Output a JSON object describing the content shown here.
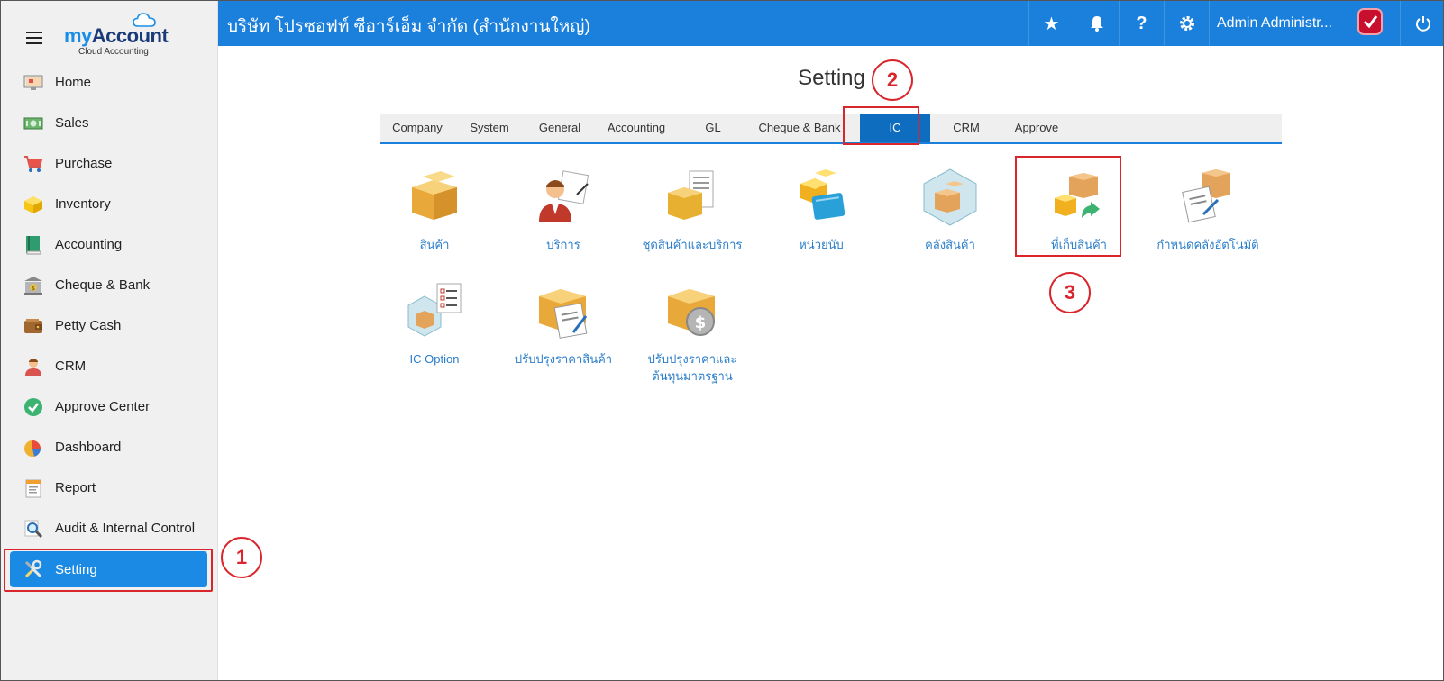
{
  "brand": {
    "logo_my": "my",
    "logo_account": "Account",
    "logo_sub": "Cloud Accounting"
  },
  "sidebar": {
    "items": [
      {
        "label": "Home",
        "icon": "home-monitor-icon"
      },
      {
        "label": "Sales",
        "icon": "cash-icon"
      },
      {
        "label": "Purchase",
        "icon": "cart-icon"
      },
      {
        "label": "Inventory",
        "icon": "box-icon"
      },
      {
        "label": "Accounting",
        "icon": "book-icon"
      },
      {
        "label": "Cheque & Bank",
        "icon": "bank-icon"
      },
      {
        "label": "Petty Cash",
        "icon": "wallet-icon"
      },
      {
        "label": "CRM",
        "icon": "person-icon"
      },
      {
        "label": "Approve Center",
        "icon": "check-circle-icon"
      },
      {
        "label": "Dashboard",
        "icon": "pie-chart-icon"
      },
      {
        "label": "Report",
        "icon": "report-icon"
      },
      {
        "label": "Audit & Internal Control",
        "icon": "magnifier-icon"
      },
      {
        "label": "Setting",
        "icon": "tools-icon",
        "active": true
      }
    ]
  },
  "topbar": {
    "company": "บริษัท โปรซอฟท์ ซีอาร์เอ็ม จำกัด (สำนักงานใหญ่)",
    "star": "★",
    "help": "?",
    "user": "Admin Administr..."
  },
  "main": {
    "title": "Setting",
    "tabs": [
      {
        "label": "Company"
      },
      {
        "label": "System"
      },
      {
        "label": "General"
      },
      {
        "label": "Accounting"
      },
      {
        "label": "GL"
      },
      {
        "label": "Cheque & Bank"
      },
      {
        "label": "IC",
        "active": true
      },
      {
        "label": "CRM"
      },
      {
        "label": "Approve"
      }
    ],
    "tiles": [
      {
        "label": "สินค้า",
        "icon": "product-boxes-icon"
      },
      {
        "label": "บริการ",
        "icon": "service-person-icon"
      },
      {
        "label": "ชุดสินค้าและบริการ",
        "icon": "product-set-icon"
      },
      {
        "label": "หน่วยนับ",
        "icon": "unit-icon"
      },
      {
        "label": "คลังสินค้า",
        "icon": "warehouse-icon"
      },
      {
        "label": "ที่เก็บสินค้า",
        "icon": "storage-location-icon"
      },
      {
        "label": "กำหนดคลังอัตโนมัติ",
        "icon": "auto-warehouse-icon"
      },
      {
        "label": "IC Option",
        "icon": "ic-option-icon"
      },
      {
        "label": "ปรับปรุงราคาสินค้า",
        "icon": "price-adjust-icon"
      },
      {
        "label": "ปรับปรุงราคาและ ต้นทุนมาตรฐาน",
        "icon": "standard-cost-icon"
      }
    ]
  },
  "steps": [
    "1",
    "2",
    "3"
  ],
  "colors": {
    "topbar": "#1b80dc",
    "active_tab": "#0f6dc0",
    "active_nav": "#1b8ae4",
    "link": "#2a7dc9",
    "annotation_red": "#d9262c"
  }
}
